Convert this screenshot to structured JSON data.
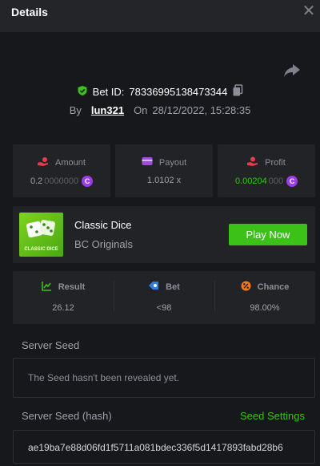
{
  "header": {
    "title": "Details",
    "close_glyph": "✕"
  },
  "bet": {
    "id_label": "Bet ID:",
    "id_value": "78336995138473344",
    "by_label": "By",
    "user": "lun321",
    "on_label": "On",
    "datetime": "28/12/2022, 15:28:35"
  },
  "stats": {
    "amount": {
      "label": "Amount",
      "value_main": "0.2",
      "value_dim": "0000000",
      "coin": "C"
    },
    "payout": {
      "label": "Payout",
      "value": "1.0102 x"
    },
    "profit": {
      "label": "Profit",
      "value_main": "0.00204",
      "value_dim": "000",
      "coin": "C"
    }
  },
  "game": {
    "thumb_label": "CLASSIC DICE",
    "name": "Classic Dice",
    "provider": "BC Originals",
    "play_label": "Play Now"
  },
  "result": {
    "result_label": "Result",
    "result_value": "26.12",
    "bet_label": "Bet",
    "bet_value": "<98",
    "chance_label": "Chance",
    "chance_value": "98.00%"
  },
  "seeds": {
    "server_seed_label": "Server Seed",
    "server_seed_text": "The Seed hasn't been revealed yet.",
    "hash_label": "Server Seed (hash)",
    "settings_link": "Seed Settings",
    "hash_value": "ae19ba7e88d06fd1f5711a081bdec336f5d1417893fabd28b6"
  },
  "colors": {
    "background": "#17181b",
    "panel": "#212327",
    "accent_green": "#3bc117",
    "coin_purple": "#9c3ce8",
    "amount_icon": "#e8394d",
    "payout_icon": "#a04be6",
    "profit_icon": "#e8394d",
    "result_icon": "#3bc117",
    "bet_icon": "#2f7de1",
    "chance_icon": "#f07b1d"
  },
  "icons": {
    "share": "share-arrow-icon",
    "shield": "shield-check-icon",
    "copy": "copy-icon",
    "amount": "hand-coin-icon",
    "payout": "wallet-icon",
    "profit": "profit-hand-icon",
    "result": "result-chart-icon",
    "bet": "target-icon",
    "chance": "percent-icon"
  }
}
